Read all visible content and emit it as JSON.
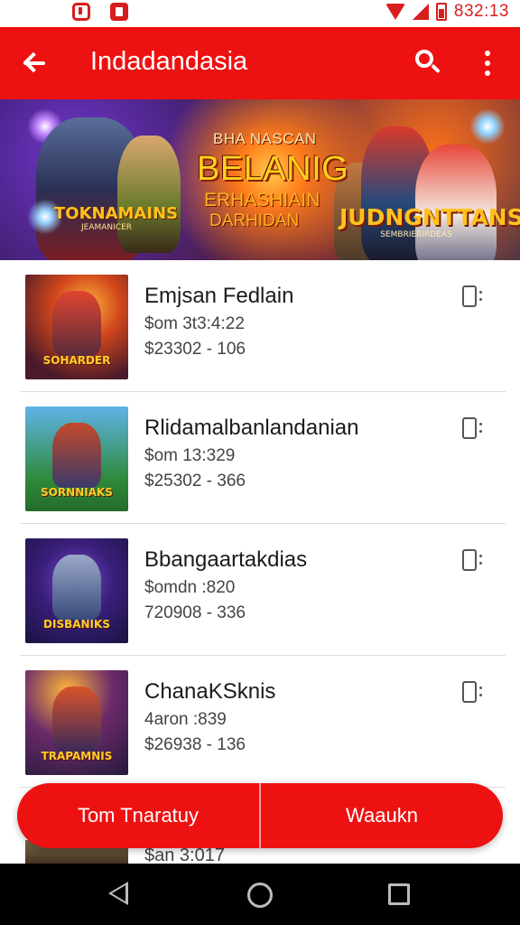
{
  "status_bar": {
    "time": "832:13",
    "left_icons": [
      "notification-icon",
      "app-icon"
    ],
    "right_icons": [
      "wifi-icon",
      "signal-icon",
      "battery-icon"
    ]
  },
  "app_bar": {
    "title": "Indadandasia",
    "back_icon": "arrow-left-icon",
    "search_icon": "search-icon",
    "more_icon": "more-vert-icon",
    "color": "#ee1111"
  },
  "banner": {
    "line1": "BHA NASCAN",
    "line2": "BELANIG",
    "line3": "ERHASHIAIN",
    "line4": "DARHIDAN",
    "logo_left_title": "TOKNAMAINS",
    "logo_left_sub": "JEAMANICER",
    "logo_right_title": "JUDNGNTTANS",
    "logo_right_sub": "SEMBRIEBIRDEAS"
  },
  "list": {
    "items": [
      {
        "name": "Emjsan Fedlain",
        "line1": "$om 3t3:4:22",
        "line2": "$23302 - 106",
        "thumb_label": "SOHARDER",
        "icon": "bookmark-icon"
      },
      {
        "name": "Rlidamalbanlandanian",
        "line1": "$om 13:329",
        "line2": "$25302 - 366",
        "thumb_label": "SORNNIAKS",
        "icon": "bookmark-icon"
      },
      {
        "name": "Bbangaartakdias",
        "line1": "$omdn :820",
        "line2": "720908 - 336",
        "thumb_label": "DISBANIKS",
        "icon": "bookmark-icon"
      },
      {
        "name": "ChanaKSknis",
        "line1": "4aron :839",
        "line2": "$26938 - 136",
        "thumb_label": "TRAPAMNIS",
        "icon": "bookmark-icon"
      }
    ],
    "partial_text": "$an 3:017"
  },
  "action_bar": {
    "left_label": "Tom Tnaratuy",
    "right_label": "Waaukn",
    "color": "#ee1111"
  },
  "nav_bar": {
    "icons": [
      "nav-back-icon",
      "nav-home-icon",
      "nav-recents-icon"
    ]
  }
}
